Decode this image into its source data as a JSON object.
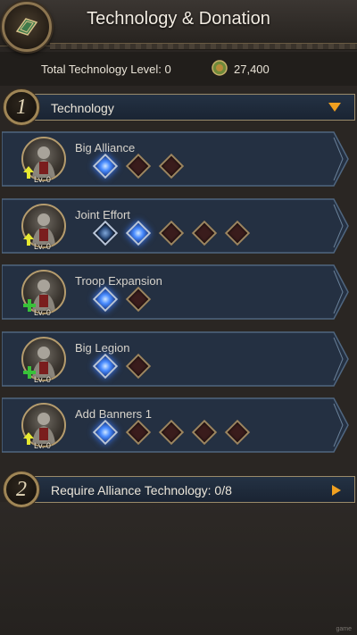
{
  "header": {
    "title": "Technology & Donation"
  },
  "summary": {
    "level_label": "Total Technology Level: 0",
    "coins": "27,400"
  },
  "sections": [
    {
      "number": "1",
      "label": "Technology"
    },
    {
      "number": "2",
      "label": "Require Alliance Technology: 0/8"
    }
  ],
  "techs": [
    {
      "name": "Big Alliance",
      "level": "Lv. 0",
      "gems": [
        "on",
        "off",
        "off"
      ],
      "badge": "up"
    },
    {
      "name": "Joint Effort",
      "level": "Lv. 0",
      "gems": [
        "half",
        "on",
        "off",
        "off",
        "off"
      ],
      "badge": "up"
    },
    {
      "name": "Troop Expansion",
      "level": "Lv. 0",
      "gems": [
        "on",
        "off"
      ],
      "badge": "plus"
    },
    {
      "name": "Big Legion",
      "level": "Lv. 0",
      "gems": [
        "on",
        "off"
      ],
      "badge": "plus"
    },
    {
      "name": "Add Banners 1",
      "level": "Lv. 0",
      "gems": [
        "on",
        "off",
        "off",
        "off",
        "off"
      ],
      "badge": "up"
    }
  ],
  "footer": {
    "watermark": "game"
  },
  "colors": {
    "accent_gold": "#b59c6e",
    "gem_blue": "#4a8cff",
    "arrow_orange": "#f0a020"
  }
}
